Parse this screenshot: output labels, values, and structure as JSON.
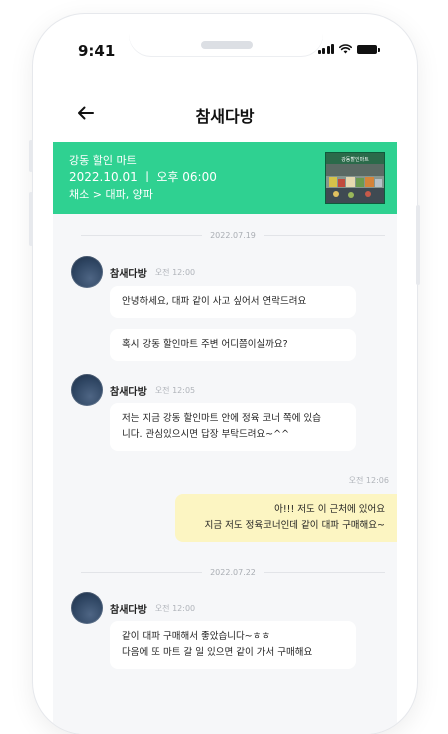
{
  "status_bar": {
    "time": "9:41"
  },
  "header": {
    "title": "참새다방",
    "back_icon": "arrow-left-icon"
  },
  "banner": {
    "store": "강동 할인 마트",
    "datetime": "2022.10.01 ㅣ 오후  06:00",
    "items": "채소 > 대파, 양파",
    "image_sign": "강동할인마트",
    "bg_color": "#2fd191"
  },
  "chat": {
    "date1": "2022.07.19",
    "m1": {
      "sender": "참새다방",
      "time": "오전 12:00"
    },
    "m1_b1": "안녕하세요, 대파 같이 사고 싶어서 연락드려요",
    "m1_b2": "혹시 강동 할인마트 주변 어디쯤이실까요?",
    "m2": {
      "sender": "참새다방",
      "time": "오전 12:05"
    },
    "m2_b1_l1": "저는 지금 강동 할인마트 안에 정육 코너 쪽에 있습",
    "m2_b1_l2": "니다. 관심있으시면 답장 부탁드려요~^^",
    "my_time": "오전 12:06",
    "my_l1": "아!!! 저도 이 근처에 있어요",
    "my_l2": "지금 저도 정육코너인데 같이 대파 구매해요~",
    "date2": "2022.07.22",
    "m3": {
      "sender": "참새다방",
      "time": "오전 12:00"
    },
    "m3_b1_l1": "같이 대파 구매해서 좋았습니다~ㅎㅎ",
    "m3_b1_l2": "다음에 또 마트 갈 일 있으면 같이 가서 구매해요",
    "my_bubble_color": "#fcf5c2"
  }
}
